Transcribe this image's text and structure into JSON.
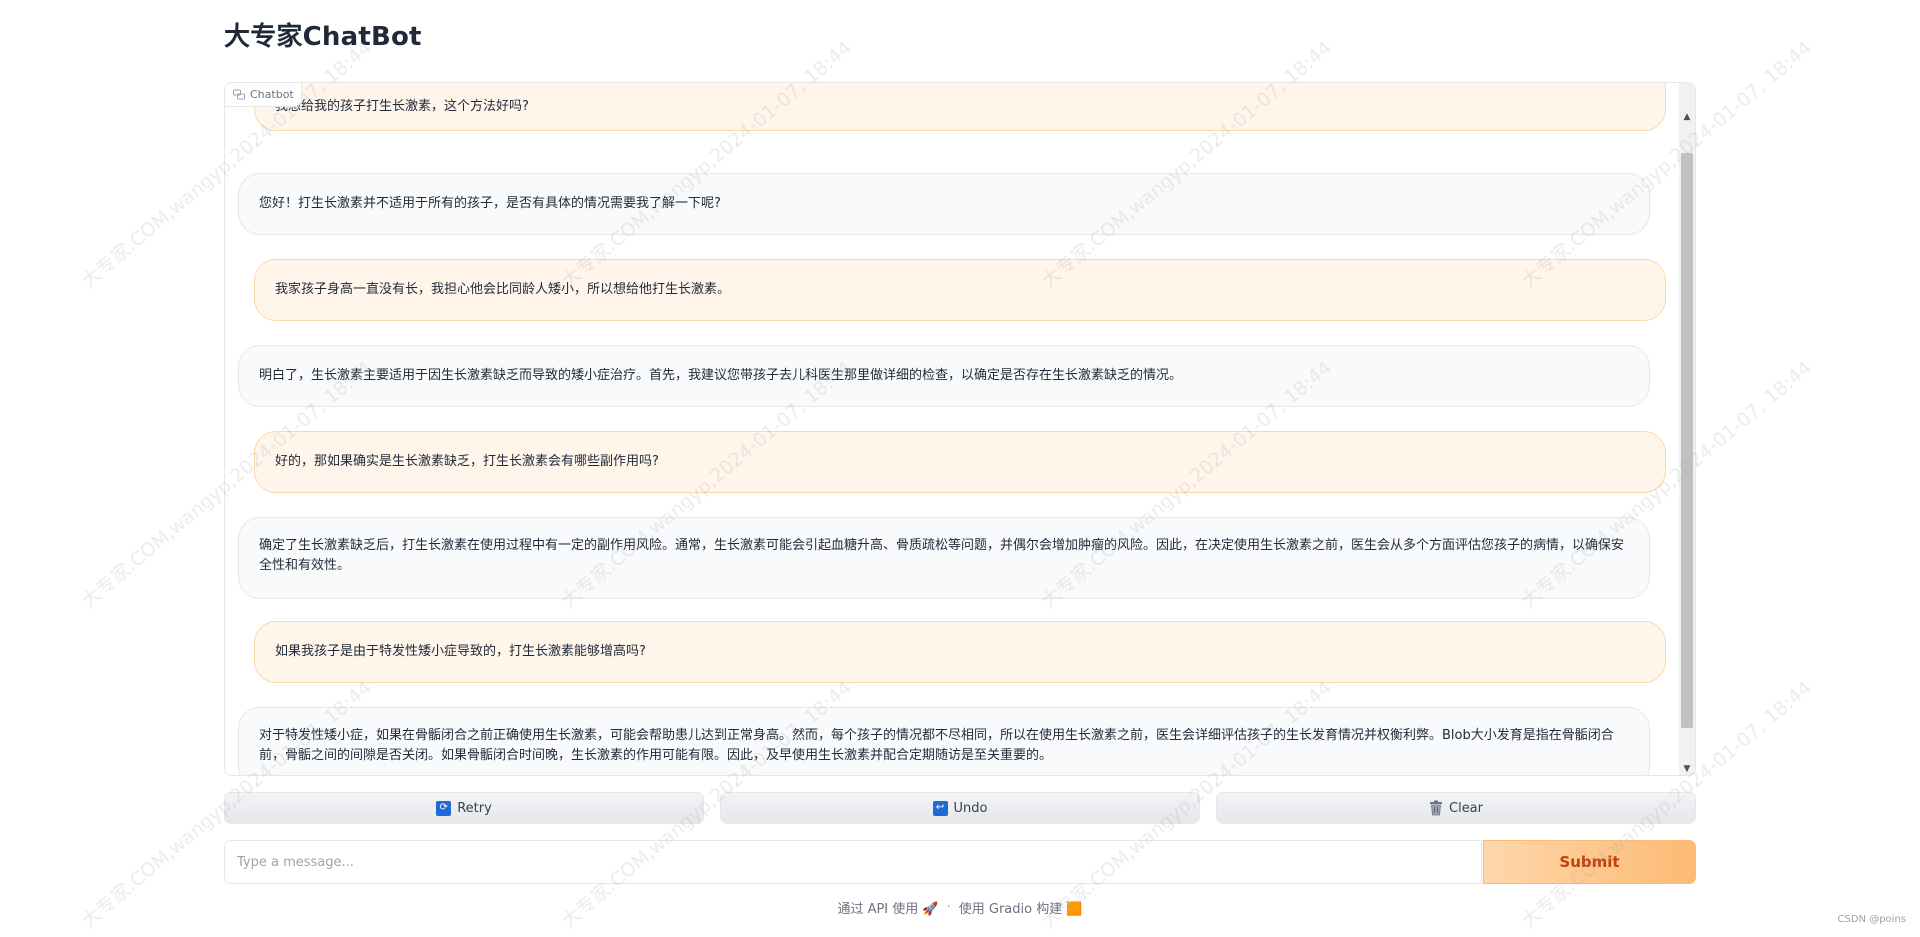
{
  "app": {
    "title": "大专家ChatBot"
  },
  "chatbot": {
    "label": "Chatbot",
    "messages": [
      {
        "role": "user",
        "text": "我想给我的孩子打生长激素，这个方法好吗?"
      },
      {
        "role": "bot",
        "text": "您好！打生长激素并不适用于所有的孩子，是否有具体的情况需要我了解一下呢?"
      },
      {
        "role": "user",
        "text": "我家孩子身高一直没有长，我担心他会比同龄人矮小，所以想给他打生长激素。"
      },
      {
        "role": "bot",
        "text": "明白了，生长激素主要适用于因生长激素缺乏而导致的矮小症治疗。首先，我建议您带孩子去儿科医生那里做详细的检查，以确定是否存在生长激素缺乏的情况。"
      },
      {
        "role": "user",
        "text": "好的，那如果确实是生长激素缺乏，打生长激素会有哪些副作用吗?"
      },
      {
        "role": "bot",
        "text": "确定了生长激素缺乏后，打生长激素在使用过程中有一定的副作用风险。通常，生长激素可能会引起血糖升高、骨质疏松等问题，并偶尔会增加肿瘤的风险。因此，在决定使用生长激素之前，医生会从多个方面评估您孩子的病情，以确保安全性和有效性。"
      },
      {
        "role": "user",
        "text": "如果我孩子是由于特发性矮小症导致的，打生长激素能够增高吗?"
      },
      {
        "role": "bot",
        "text": "对于特发性矮小症，如果在骨骺闭合之前正确使用生长激素，可能会帮助患儿达到正常身高。然而，每个孩子的情况都不尽相同，所以在使用生长激素之前，医生会详细评估孩子的生长发育情况并权衡利弊。Blob大小发育是指在骨骺闭合前，骨骺之间的间隙是否关闭。如果骨骺闭合时间晚，生长激素的作用可能有限。因此，及早使用生长激素并配合定期随访是至关重要的。"
      }
    ]
  },
  "buttons": {
    "retry": "Retry",
    "undo": "Undo",
    "clear": "Clear",
    "submit": "Submit"
  },
  "input": {
    "placeholder": "Type a message...",
    "value": ""
  },
  "footer": {
    "api_text": "通过 API 使用",
    "separator": "·",
    "built_text": "使用 Gradio 构建"
  },
  "watermark": {
    "text": "大专家.COM,wangyp,2024-01-07, 18:44",
    "credit": "CSDN @poins"
  },
  "colors": {
    "user_bubble": "#fff5eb",
    "bot_bubble": "#f9fafb",
    "submit_accent": "#fdba74",
    "submit_text": "#c2410c"
  }
}
